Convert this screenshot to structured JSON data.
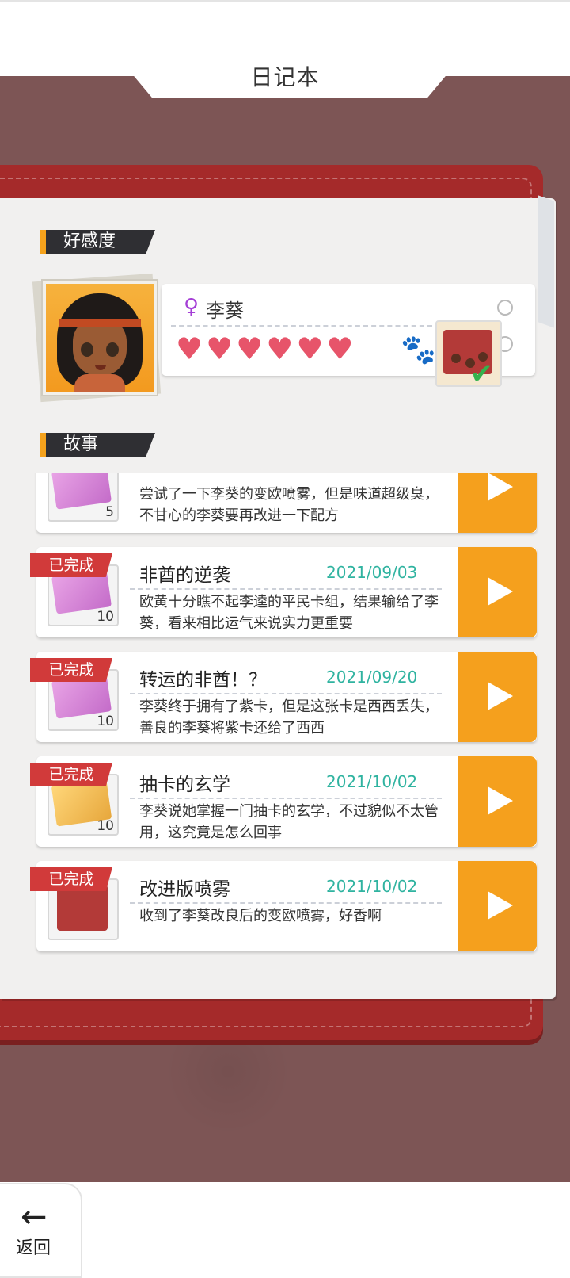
{
  "header": {
    "title": "日记本"
  },
  "sections": {
    "affinity": "好感度",
    "story": "故事"
  },
  "character": {
    "name": "李葵",
    "gender_icon": "♀",
    "hearts": 6,
    "heart_glyph": "♥",
    "gift_checked": true
  },
  "stories": [
    {
      "title": "",
      "date": "",
      "desc": "尝试了一下李葵的变欧喷雾，但是味道超级臭，不甘心的李葵要再改进一下配方",
      "badge": "",
      "count": "5",
      "thumb": "pink-ticket"
    },
    {
      "title": "非酋的逆袭",
      "date": "2021/09/03",
      "desc": "欧黄十分瞧不起李逵的平民卡组，结果输给了李葵，看来相比运气来说实力更重要",
      "badge": "已完成",
      "count": "10",
      "thumb": "pink-ticket"
    },
    {
      "title": "转运的非酋！？",
      "date": "2021/09/20",
      "desc": "李葵终于拥有了紫卡，但是这张卡是西西丢失，善良的李葵将紫卡还给了西西",
      "badge": "已完成",
      "count": "10",
      "thumb": "pink-ticket"
    },
    {
      "title": "抽卡的玄学",
      "date": "2021/10/02",
      "desc": "李葵说她掌握一门抽卡的玄学，不过貌似不太管用，这究竟是怎么回事",
      "badge": "已完成",
      "count": "10",
      "thumb": "gold-ticket"
    },
    {
      "title": "改进版喷雾",
      "date": "2021/10/02",
      "desc": "收到了李葵改良后的变欧喷雾，好香啊",
      "badge": "已完成",
      "count": "",
      "thumb": "red-package"
    }
  ],
  "footer": {
    "back_label": "返回",
    "back_icon": "←"
  },
  "colors": {
    "accent": "#f5a01d",
    "badge": "#d13a3a",
    "date": "#2fb3a0",
    "heart": "#e7546a",
    "board": "#7d5555",
    "book": "#a52a2a"
  }
}
